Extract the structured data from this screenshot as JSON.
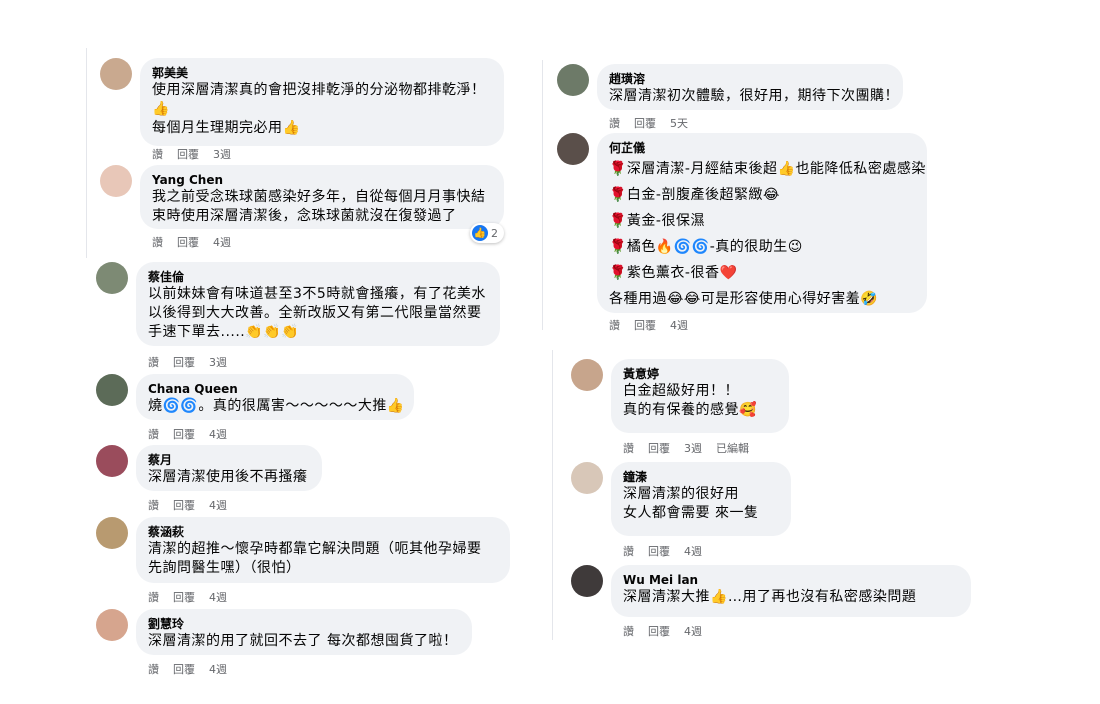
{
  "left_column": [
    {
      "name": "郭美美",
      "lines": [
        "使用深層清潔真的會把沒排乾淨的分泌物都排乾淨！",
        "👍",
        "每個月生理期完必用👍"
      ],
      "actions": [
        "讚",
        "回覆"
      ],
      "time": "3週"
    },
    {
      "name": "Yang Chen",
      "lines": [
        "我之前受念珠球菌感染好多年，自從每個月月事快結",
        "束時使用深層清潔後，念珠球菌就沒在復發過了"
      ],
      "actions": [
        "讚",
        "回覆"
      ],
      "time": "4週",
      "reaction_count": "2"
    },
    {
      "name": "蔡佳倫",
      "lines": [
        "以前妹妹會有味道甚至3不5時就會搔癢，有了花美水",
        "以後得到大大改善。全新改版又有第二代限量當然要",
        "手速下單去.....👏👏👏"
      ],
      "actions": [
        "讚",
        "回覆"
      ],
      "time": "3週"
    },
    {
      "name": "Chana Queen",
      "lines": [
        "燒🌀🌀。真的很厲害～～～～～大推👍"
      ],
      "actions": [
        "讚",
        "回覆"
      ],
      "time": "4週"
    },
    {
      "name": "蔡月",
      "lines": [
        "深層清潔使用後不再搔癢"
      ],
      "actions": [
        "讚",
        "回覆"
      ],
      "time": "4週"
    },
    {
      "name": "蔡涵萩",
      "lines": [
        "清潔的超推～懷孕時都靠它解決問題（呃其他孕婦要",
        "先詢問醫生嘿）（很怕）"
      ],
      "actions": [
        "讚",
        "回覆"
      ],
      "time": "4週"
    },
    {
      "name": "劉慧玲",
      "lines": [
        "深層清潔的用了就回不去了 每次都想囤貨了啦！"
      ],
      "actions": [
        "讚",
        "回覆"
      ],
      "time": "4週"
    }
  ],
  "right_column": [
    {
      "name": "趙璜溶",
      "lines": [
        "深層清潔初次體驗，很好用，期待下次團購！"
      ],
      "actions": [
        "讚",
        "回覆"
      ],
      "time": "5天"
    },
    {
      "name": "何芷儀",
      "lines": [
        "🌹深層清潔-月經結束後超👍也能降低私密處感染",
        "🌹白金-剖腹產後超緊緻😂",
        "🌹黃金-很保濕",
        "🌹橘色🔥🌀🌀-真的很助生😉",
        "🌹紫色薰衣-很香❤️",
        "各種用過😂😂可是形容使用心得好害羞🤣"
      ],
      "actions": [
        "讚",
        "回覆"
      ],
      "time": "4週"
    },
    {
      "name": "黃意婷",
      "lines": [
        "白金超級好用！！",
        "真的有保養的感覺🥰"
      ],
      "actions": [
        "讚",
        "回覆"
      ],
      "time": "3週",
      "edited": "已編輯"
    },
    {
      "name": "鐘溱",
      "lines": [
        "深層清潔的很好用",
        "女人都會需要 來一隻"
      ],
      "actions": [
        "讚",
        "回覆"
      ],
      "time": "4週"
    },
    {
      "name": "Wu Mei lan",
      "lines": [
        "深層清潔大推👍…用了再也沒有私密感染問題"
      ],
      "actions": [
        "讚",
        "回覆"
      ],
      "time": "4週"
    }
  ],
  "colors": {
    "bubble": "#f0f2f5",
    "name": "#050505",
    "meta": "#65676b",
    "like": "#1877f2"
  },
  "avatar_colors": [
    "#c9a98f",
    "#e8c7b8",
    "#7d8a74",
    "#5c6b58",
    "#9a4c5c",
    "#b89a70",
    "#d6a58e",
    "#6d7a68",
    "#5a4f4a",
    "#c7a58c",
    "#d8c7b8",
    "#3f3a3a"
  ]
}
